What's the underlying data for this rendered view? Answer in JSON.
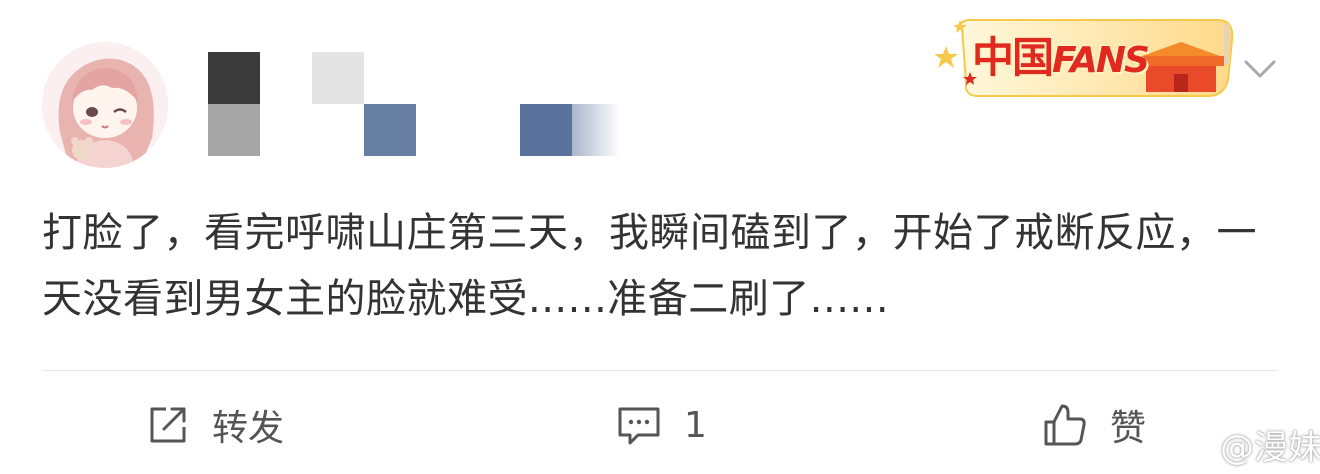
{
  "post": {
    "text": "打脸了，看完呼啸山庄第三天，我瞬间磕到了，开始了戒断反应，一天没看到男女主的脸就难受......准备二刷了......"
  },
  "badge": {
    "icon": "china-fans-badge",
    "text_cn": "中国",
    "text_en": "FANS"
  },
  "actions": {
    "repost_label": "转发",
    "comment_count": "1",
    "like_label": "赞"
  },
  "watermark": {
    "icon": "weibo-logo-icon",
    "text": "@漫妹"
  },
  "colors": {
    "text": "#333333",
    "badge_red": "#e02a1f",
    "badge_gold": "#f7c94a",
    "divider": "#e6e6e6"
  }
}
